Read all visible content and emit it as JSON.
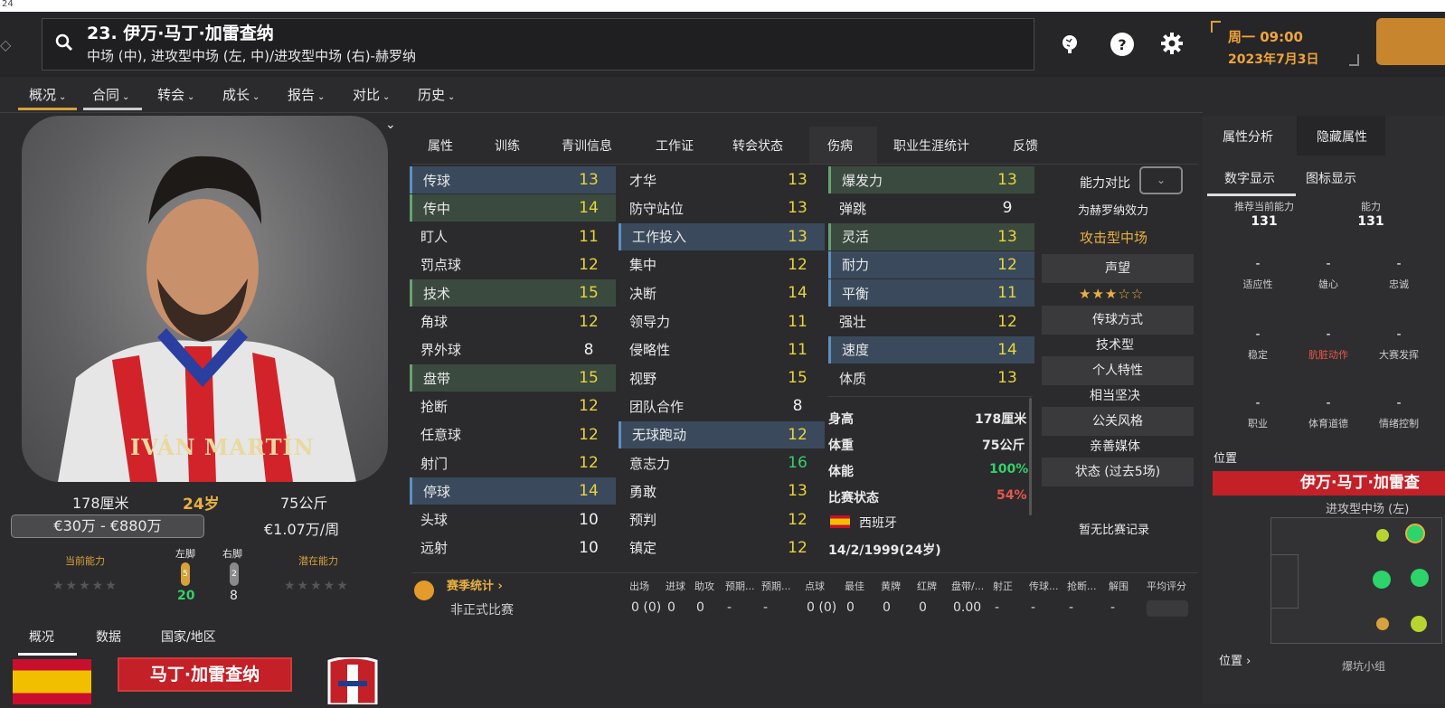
{
  "top_strip": "24",
  "header": {
    "title": "23. 伊万·马丁·加雷查纳",
    "subtitle": "中场 (中), 进攻型中场 (左, 中)/进攻型中场 (右)-赫罗纳",
    "help_label": "?",
    "date_line1": "周一 09:00",
    "date_line2": "2023年7月3日"
  },
  "nav": {
    "items": [
      "概况",
      "合同",
      "转会",
      "成长",
      "报告",
      "对比",
      "历史"
    ],
    "chevron": "⌄"
  },
  "player_photo": {
    "name_on_shirt": "IVÁN MARTÍN"
  },
  "left_stats": {
    "height": "178厘米",
    "age": "24岁",
    "weight": "75公斤",
    "value": "€30万 - €880万",
    "wage": "€1.07万/周",
    "current_ability_label": "当前能力",
    "left_foot_label": "左脚",
    "right_foot_label": "右脚",
    "potential_ability_label": "潜在能力",
    "left_foot_badge": "5",
    "right_foot_badge": "2",
    "left_foot_value": "20",
    "right_foot_value": "8",
    "stars_empty": "★★★★★"
  },
  "bottom_tabs": [
    "概况",
    "数据",
    "国家/地区"
  ],
  "name_badge": "马丁·加雷查纳",
  "tabs": [
    "属性",
    "训练",
    "青训信息",
    "工作证",
    "转会状态",
    "伤病",
    "职业生涯统计",
    "反馈"
  ],
  "attributes": {
    "technical": [
      {
        "name": "传球",
        "value": "13"
      },
      {
        "name": "传中",
        "value": "14"
      },
      {
        "name": "盯人",
        "value": "11"
      },
      {
        "name": "罚点球",
        "value": "12"
      },
      {
        "name": "技术",
        "value": "15"
      },
      {
        "name": "角球",
        "value": "12"
      },
      {
        "name": "界外球",
        "value": "8"
      },
      {
        "name": "盘带",
        "value": "15"
      },
      {
        "name": "抢断",
        "value": "12"
      },
      {
        "name": "任意球",
        "value": "12"
      },
      {
        "name": "射门",
        "value": "12"
      },
      {
        "name": "停球",
        "value": "14"
      },
      {
        "name": "头球",
        "value": "10"
      },
      {
        "name": "远射",
        "value": "10"
      }
    ],
    "mental": [
      {
        "name": "才华",
        "value": "13"
      },
      {
        "name": "防守站位",
        "value": "13"
      },
      {
        "name": "工作投入",
        "value": "13"
      },
      {
        "name": "集中",
        "value": "12"
      },
      {
        "name": "决断",
        "value": "14"
      },
      {
        "name": "领导力",
        "value": "11"
      },
      {
        "name": "侵略性",
        "value": "11"
      },
      {
        "name": "视野",
        "value": "15"
      },
      {
        "name": "团队合作",
        "value": "8"
      },
      {
        "name": "无球跑动",
        "value": "12"
      },
      {
        "name": "意志力",
        "value": "16"
      },
      {
        "name": "勇敢",
        "value": "13"
      },
      {
        "name": "预判",
        "value": "12"
      },
      {
        "name": "镇定",
        "value": "12"
      }
    ],
    "physical": [
      {
        "name": "爆发力",
        "value": "13"
      },
      {
        "name": "弹跳",
        "value": "9"
      },
      {
        "name": "灵活",
        "value": "13"
      },
      {
        "name": "耐力",
        "value": "12"
      },
      {
        "name": "平衡",
        "value": "11"
      },
      {
        "name": "强壮",
        "value": "12"
      },
      {
        "name": "速度",
        "value": "14"
      },
      {
        "name": "体质",
        "value": "13"
      }
    ]
  },
  "physical_info": {
    "height_label": "身高",
    "height": "178厘米",
    "weight_label": "体重",
    "weight": "75公斤",
    "fitness_label": "体能",
    "fitness": "100%",
    "match_label": "比赛状态",
    "match": "54%",
    "nation": "西班牙",
    "dob": "14/2/1999(24岁)"
  },
  "mid_panel": {
    "compare_label": "能力对比",
    "for_club": "为赫罗纳效力",
    "role": "攻击型中场",
    "reputation": "声望",
    "reputation_stars": "★★★☆☆",
    "passing_style": "传球方式",
    "passing_value": "技术型",
    "personality": "个人特性",
    "personality_value": "相当坚决",
    "media": "公关风格",
    "media_value": "亲善媒体",
    "form": "状态 (过去5场)",
    "no_matches": "暂无比赛记录"
  },
  "season": {
    "title": "赛季统计 ›",
    "columns": [
      "出场",
      "进球",
      "助攻",
      "预期...",
      "预期...",
      "点球",
      "最佳",
      "黄牌",
      "红牌",
      "盘带/...",
      "射正",
      "传球...",
      "抢断...",
      "解围",
      "平均评分"
    ],
    "row_label": "非正式比赛",
    "row_values": [
      "0 (0)",
      "0",
      "0",
      "-",
      "-",
      "0 (0)",
      "0",
      "0",
      "0",
      "0.00",
      "-",
      "-",
      "-",
      "-",
      "-"
    ]
  },
  "right_panel": {
    "tabs": [
      "属性分析",
      "隐藏属性"
    ],
    "subtabs": [
      "数字显示",
      "图标显示"
    ],
    "recommended_label": "推荐当前能力",
    "recommended_value": "131",
    "ability_label": "能力",
    "ability_value": "131",
    "dash": "-",
    "labels_row1": [
      "适应性",
      "雄心",
      "忠诚"
    ],
    "labels_row2": [
      "稳定",
      "肮脏动作",
      "大赛发挥"
    ],
    "labels_row3": [
      "职业",
      "体育道德",
      "情绪控制"
    ],
    "position_label": "位置",
    "position_name": "伊万·马丁·加雷查",
    "position_role": "进攻型中场 (左)",
    "position_link": "位置 ›",
    "watermark": "爆坑小组"
  },
  "colors": {
    "accent": "#d7a13b",
    "date": "#f0a43a",
    "highlight": "#3a4a5c",
    "green": "#34d06a",
    "red": "#c42027"
  }
}
